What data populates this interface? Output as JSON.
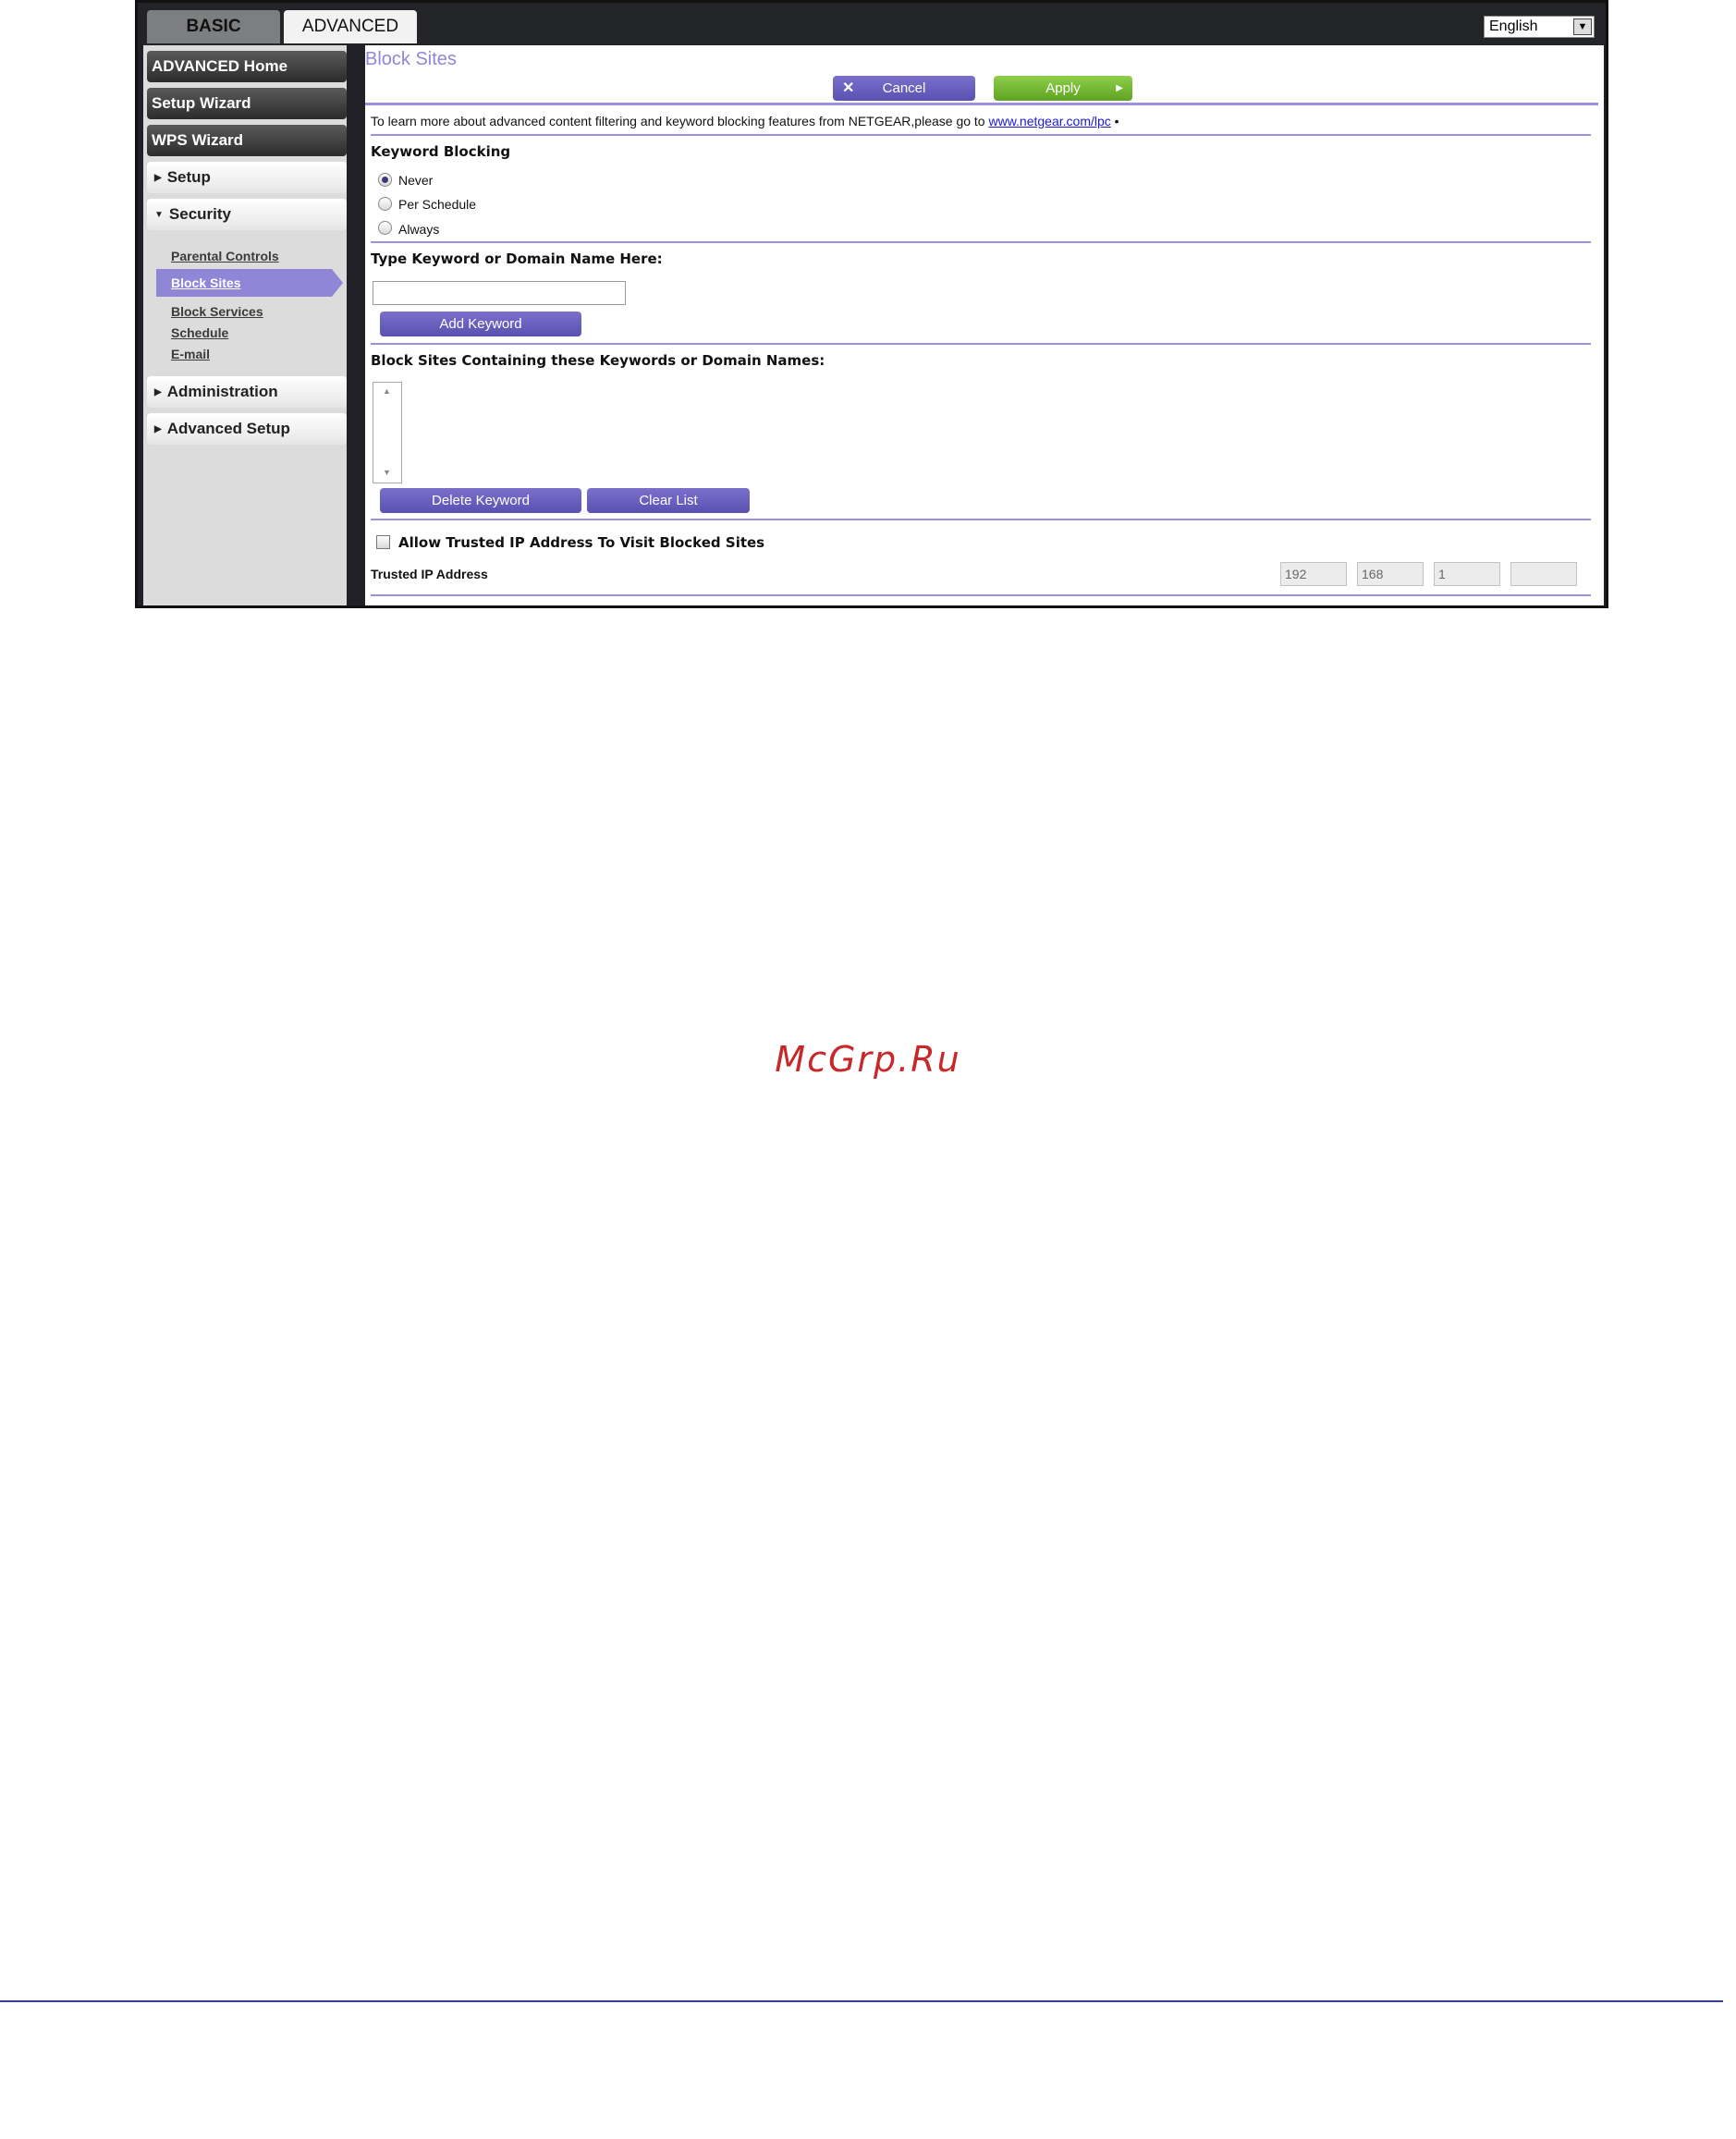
{
  "tabs": {
    "basic": "BASIC",
    "advanced": "ADVANCED"
  },
  "language": "English",
  "sidebar": {
    "advanced_home": "ADVANCED Home",
    "setup_wizard": "Setup Wizard",
    "wps_wizard": "WPS Wizard",
    "setup": "Setup",
    "security": "Security",
    "security_items": [
      "Parental Controls",
      "Block Sites",
      "Block Services",
      "Schedule",
      "E-mail"
    ],
    "administration": "Administration",
    "advanced_setup": "Advanced Setup"
  },
  "main": {
    "title": "Block Sites",
    "cancel": "Cancel",
    "apply": "Apply",
    "info_text": "To learn more about advanced content filtering and keyword blocking features from NETGEAR,please go to",
    "info_link": "www.netgear.com/lpc",
    "keyword_blocking_label": "Keyword Blocking",
    "radio_never": "Never",
    "radio_per_schedule": "Per Schedule",
    "radio_always": "Always",
    "selected_option": "Never",
    "type_keyword_label": "Type Keyword or Domain Name Here:",
    "keyword_input_value": "",
    "add_keyword": "Add Keyword",
    "block_list_label": "Block Sites Containing these Keywords or Domain Names:",
    "delete_keyword": "Delete Keyword",
    "clear_list": "Clear List",
    "allow_trusted_label": "Allow Trusted IP Address To Visit Blocked Sites",
    "trusted_ip_label": "Trusted IP Address",
    "trusted_ip": [
      "192",
      "168",
      "1",
      ""
    ]
  },
  "watermark": "McGrp.Ru"
}
